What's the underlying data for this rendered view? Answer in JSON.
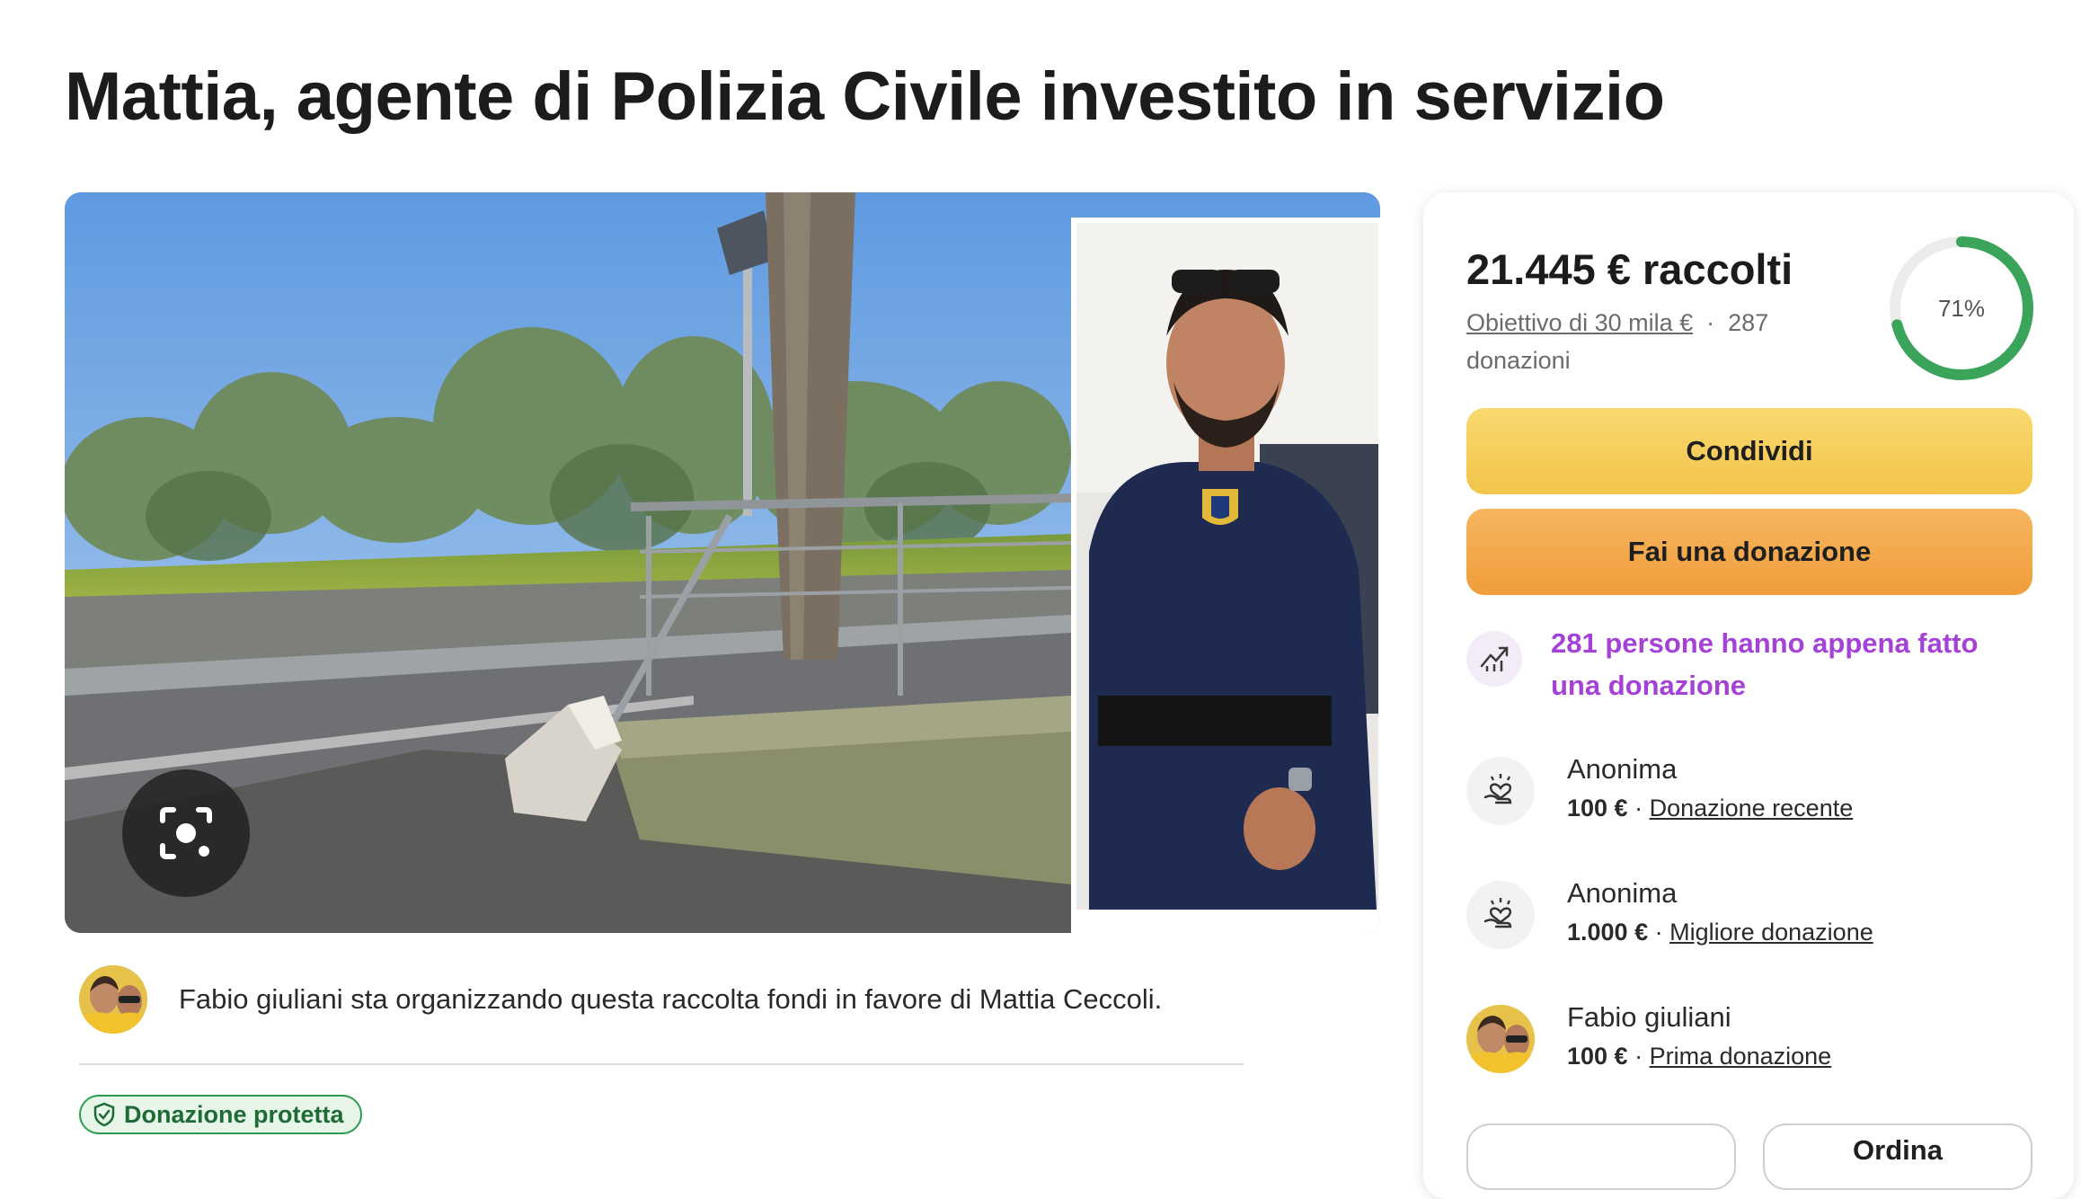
{
  "page": {
    "title": "Mattia, agente di Polizia Civile investito in servizio"
  },
  "organizer": {
    "text": "Fabio giuliani sta organizzando questa raccolta fondi in favore di Mattia Ceccoli."
  },
  "badge": {
    "label": "Donazione protetta",
    "icon": "shield-check-icon",
    "color": "#2f9a52"
  },
  "summary": {
    "raised": "21.445 € raccolti",
    "goal_link": "Obiettivo di 30 mila €",
    "separator": "·",
    "donations_count": "287",
    "donations_word": "donazioni",
    "progress_label": "71%",
    "progress_fraction": 0.71,
    "progress_color": "#3aa55a"
  },
  "buttons": {
    "share": "Condividi",
    "donate": "Fai una donazione",
    "sort": "Ordina"
  },
  "trend": {
    "text": "281 persone hanno appena fatto una donazione",
    "icon": "trending-up-icon",
    "color": "#a542d6"
  },
  "donors": [
    {
      "name": "Anonima",
      "amount": "100 €",
      "sep": " · ",
      "tag": "Donazione recente",
      "icon": "heart-hand-icon"
    },
    {
      "name": "Anonima",
      "amount": "1.000 €",
      "sep": " · ",
      "tag": "Migliore donazione",
      "icon": "heart-hand-icon"
    },
    {
      "name": "Fabio giuliani",
      "amount": "100 €",
      "sep": " · ",
      "tag": "Prima donazione",
      "icon": "avatar"
    }
  ],
  "icons": {
    "lens": "camera-search-icon"
  },
  "colors": {
    "share_button": "#f5cf5e",
    "donate_button": "#f2a949"
  }
}
